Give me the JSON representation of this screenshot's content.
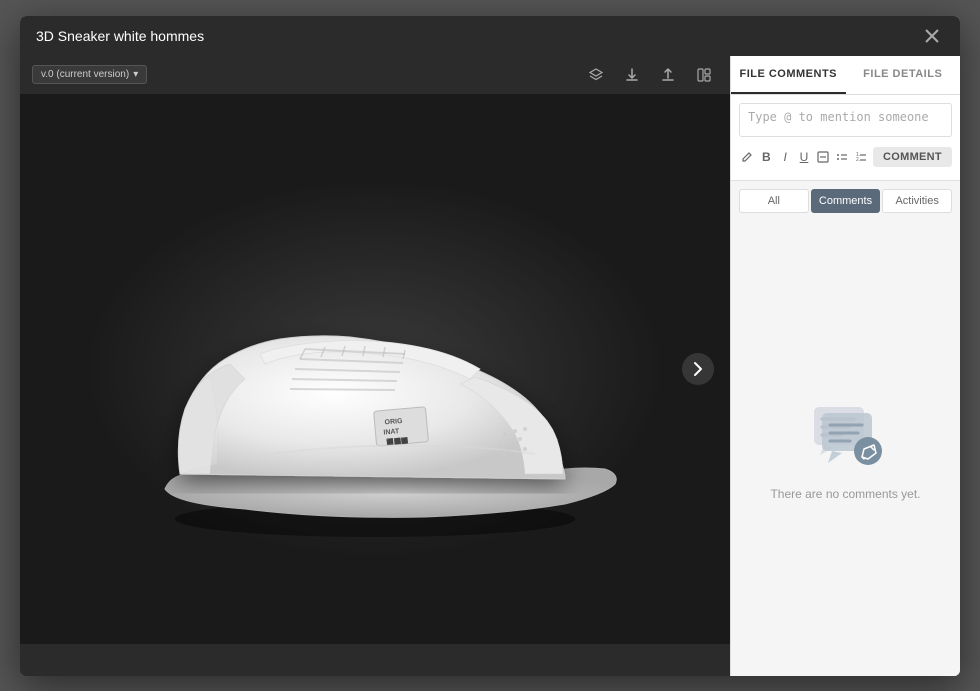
{
  "modal": {
    "title": "3D Sneaker white hommes",
    "close_label": "×"
  },
  "viewer": {
    "version_label": "v.0 (current version)",
    "version_arrow": "▾",
    "toolbar_icons": [
      "layers",
      "download",
      "upload",
      "layout"
    ],
    "next_arrow": "›"
  },
  "comments_panel": {
    "tabs": [
      {
        "id": "file-comments",
        "label": "FILE COMMENTS",
        "active": true
      },
      {
        "id": "file-details",
        "label": "FILE DETAILS",
        "active": false
      }
    ],
    "input_placeholder": "Type @ to mention someone",
    "format_buttons": [
      "✎",
      "B",
      "I",
      "U",
      "⬚",
      "≡",
      "≡"
    ],
    "comment_button_label": "COMMENT",
    "filter_tabs": [
      {
        "id": "all",
        "label": "All",
        "active": false
      },
      {
        "id": "comments",
        "label": "Comments",
        "active": true
      },
      {
        "id": "activities",
        "label": "Activities",
        "active": false
      }
    ],
    "empty_message": "There are no comments yet."
  }
}
